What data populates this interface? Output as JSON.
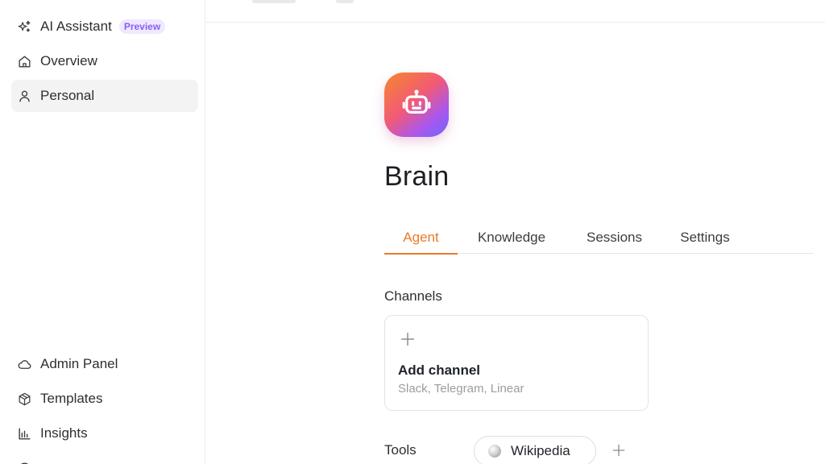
{
  "sidebar": {
    "top_items": [
      {
        "label": "AI Assistant",
        "badge": "Preview",
        "icon": "sparkles-icon"
      },
      {
        "label": "Overview",
        "icon": "home-icon"
      },
      {
        "label": "Personal",
        "icon": "user-icon",
        "active": true
      }
    ],
    "bottom_items": [
      {
        "label": "Admin Panel",
        "icon": "cloud-icon"
      },
      {
        "label": "Templates",
        "icon": "package-icon"
      },
      {
        "label": "Insights",
        "icon": "bar-chart-icon"
      }
    ]
  },
  "agent": {
    "name": "Brain",
    "avatar_icon": "robot-icon"
  },
  "tabs": [
    {
      "label": "Agent",
      "active": true
    },
    {
      "label": "Knowledge"
    },
    {
      "label": "Sessions"
    },
    {
      "label": "Settings"
    }
  ],
  "channels": {
    "heading": "Channels",
    "add_title": "Add channel",
    "add_subtitle": "Slack, Telegram, Linear"
  },
  "tools": {
    "heading": "Tools",
    "items": [
      {
        "label": "Wikipedia",
        "icon": "wikipedia-icon"
      }
    ]
  },
  "colors": {
    "accent": "#ea7a2c",
    "badge_text": "#8b5cf6",
    "badge_bg": "#efe9ff"
  }
}
